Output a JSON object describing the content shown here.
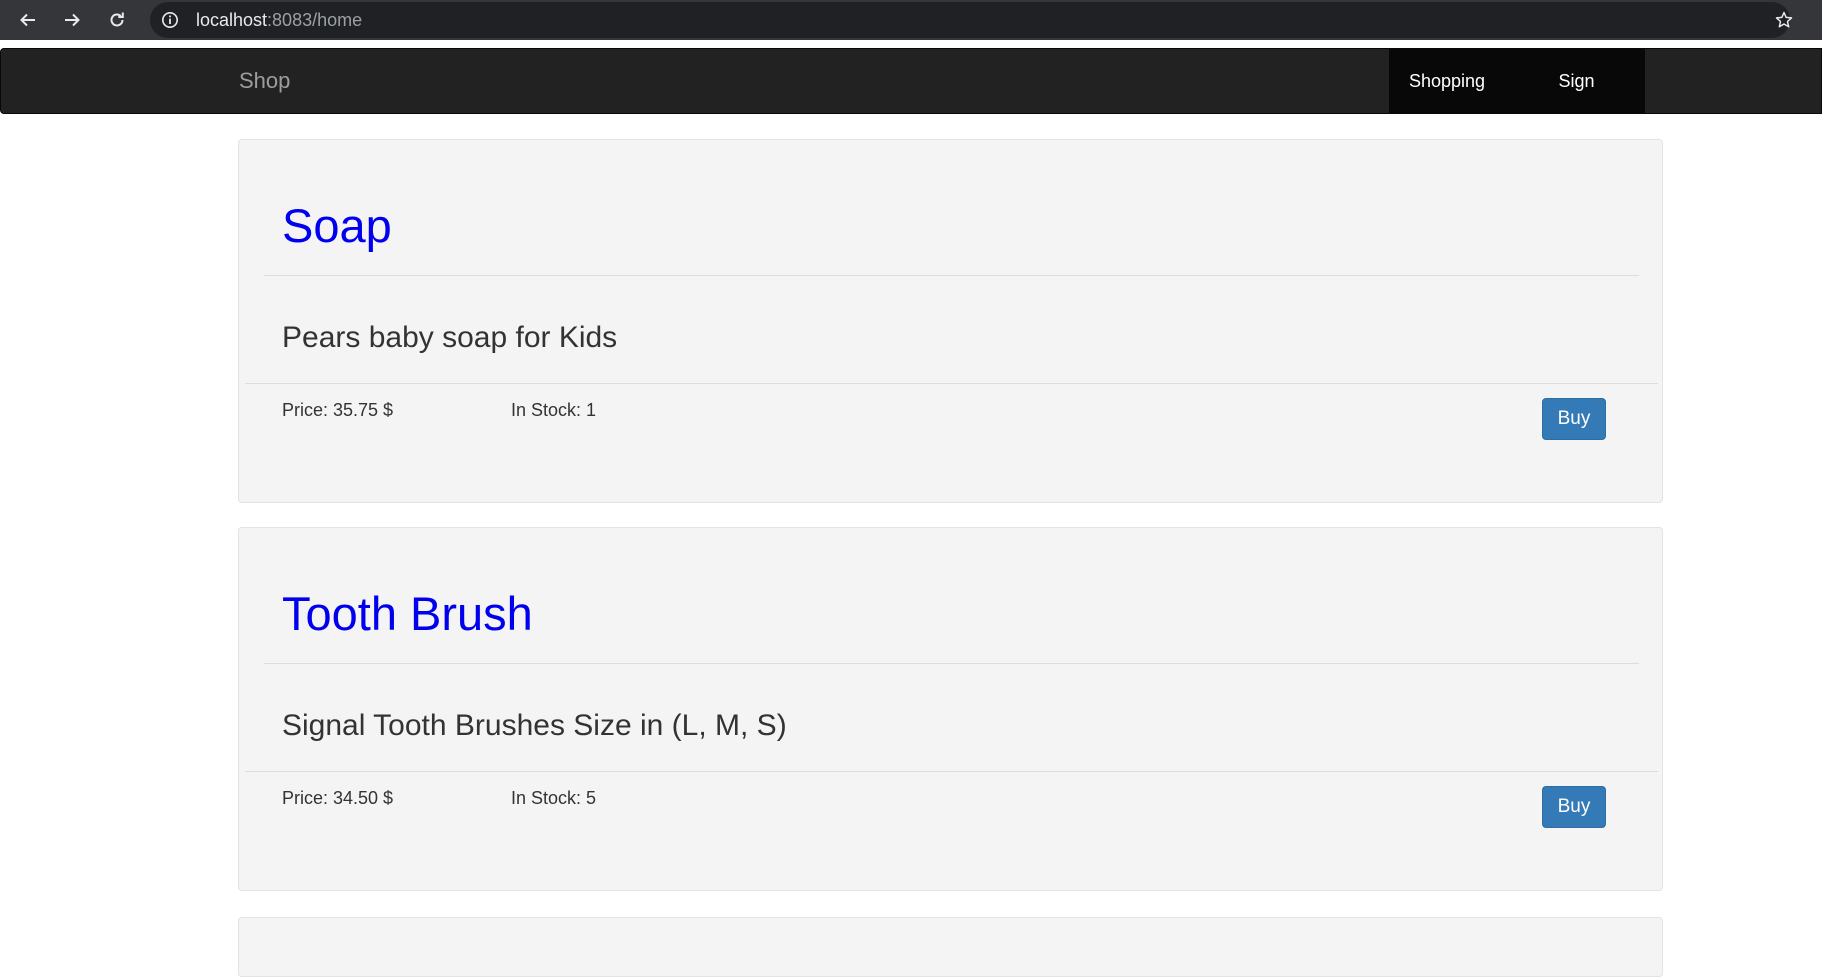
{
  "browser": {
    "url_host": "localhost",
    "url_rest": ":8083/home",
    "icons": [
      "back-arrow-icon",
      "forward-arrow-icon",
      "reload-icon",
      "info-icon",
      "star-icon"
    ]
  },
  "navbar": {
    "brand": "Shop",
    "links": [
      "Shopping Cart",
      "Sign Out"
    ]
  },
  "products": [
    {
      "title": "Soap",
      "description": "Pears baby soap for Kids",
      "price": "Price: 35.75 $",
      "stock": "In Stock: 1",
      "button": "Buy"
    },
    {
      "title": "Tooth Brush",
      "description": "Signal Tooth Brushes Size in (L, M, S)",
      "price": "Price: 34.50 $",
      "stock": "In Stock: 5",
      "button": "Buy"
    }
  ],
  "colors": {
    "chrome_bg": "#35363a",
    "navbar_bg": "#222222",
    "title_link": "#0000ee",
    "button_primary": "#337ab7",
    "card_bg": "#f4f4f4"
  }
}
